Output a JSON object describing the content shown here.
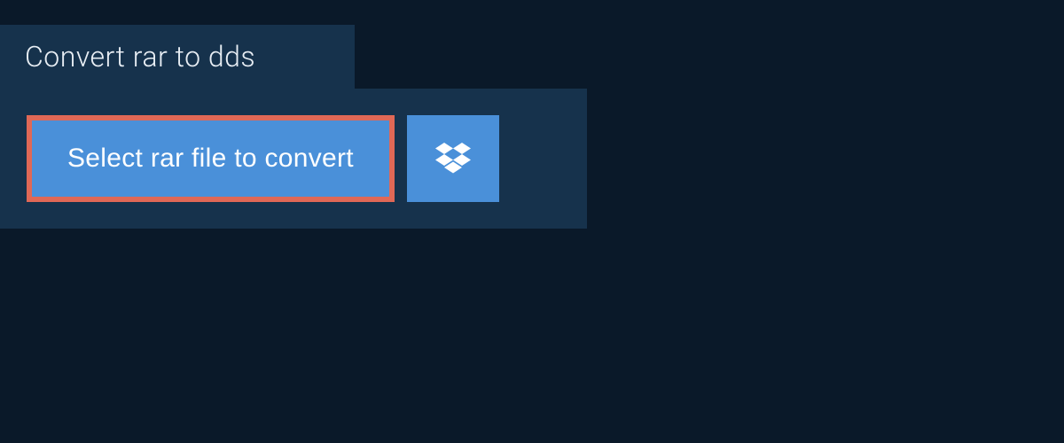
{
  "header": {
    "title": "Convert rar to dds"
  },
  "actions": {
    "select_file_label": "Select rar file to convert"
  },
  "colors": {
    "background": "#0a1929",
    "panel": "#16324c",
    "button": "#4a90d9",
    "highlight_border": "#e06856",
    "text_light": "#e8eef4",
    "text_white": "#ffffff"
  }
}
